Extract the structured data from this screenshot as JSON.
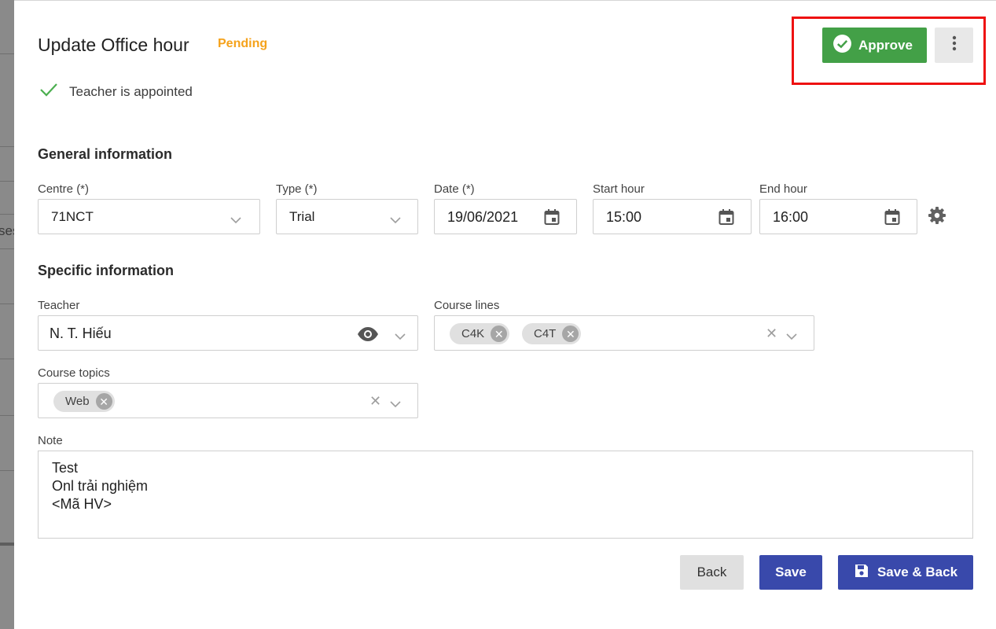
{
  "background": {
    "fragment": "ses"
  },
  "header": {
    "title": "Update Office hour",
    "status": "Pending",
    "appointed_text": "Teacher is appointed",
    "approve_label": "Approve"
  },
  "general": {
    "heading": "General information",
    "centre": {
      "label": "Centre (*)",
      "value": "71NCT"
    },
    "type": {
      "label": "Type (*)",
      "value": "Trial"
    },
    "date": {
      "label": "Date (*)",
      "value": "19/06/2021"
    },
    "start": {
      "label": "Start hour",
      "value": "15:00"
    },
    "end": {
      "label": "End hour",
      "value": "16:00"
    }
  },
  "specific": {
    "heading": "Specific information",
    "teacher": {
      "label": "Teacher",
      "value": "N. T. Hiếu"
    },
    "course_lines": {
      "label": "Course lines",
      "chips": [
        "C4K",
        "C4T"
      ]
    },
    "course_topics": {
      "label": "Course topics",
      "chips": [
        "Web"
      ]
    },
    "note": {
      "label": "Note",
      "lines": [
        "Test",
        "Onl trải nghiệm",
        "<Mã HV>"
      ]
    }
  },
  "actions": {
    "back": "Back",
    "save": "Save",
    "save_back": "Save & Back"
  },
  "colors": {
    "approve": "#43a047",
    "status": "#f5a21b",
    "primary": "#3949ab",
    "highlight": "#ee1111"
  }
}
